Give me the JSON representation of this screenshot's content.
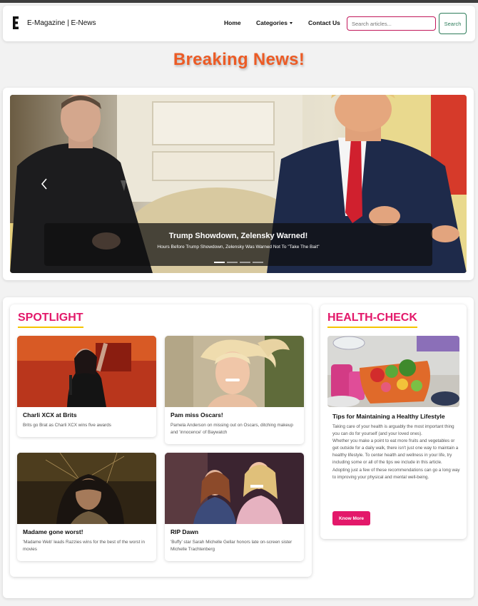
{
  "nav": {
    "brand": "E-Magazine | E-News",
    "links": [
      "Home",
      "Categories",
      "Contact Us"
    ],
    "search_placeholder": "Search articles...",
    "search_button": "Search"
  },
  "breaking": "Breaking News!",
  "carousel": {
    "title": "Trump Showdown, Zelensky Warned!",
    "subtitle": "Hours Before Trump Showdown, Zelensky Was Warned Not To \"Take The Bait\"",
    "slide_count": 4,
    "active_slide": 1
  },
  "spotlight": {
    "heading": "SPOTLIGHT",
    "items": [
      {
        "title": "Charli XCX at Brits",
        "desc": "Brits go Brat as Charli XCX wins five awards"
      },
      {
        "title": "Pam miss Oscars!",
        "desc": "Pamela Anderson on missing out on Oscars, ditching makeup and 'innocence' of Baywatch"
      },
      {
        "title": "Madame gone worst!",
        "desc": "'Madame Web' leads Razzies wins for the best of the worst in movies"
      },
      {
        "title": "RIP Dawn",
        "desc": "'Buffy' star Sarah Michelle Gellar honors late on-screen sister Michelle Trachtenberg"
      }
    ]
  },
  "health": {
    "heading": "HEALTH-CHECK",
    "title": "Tips for Maintaining a Healthy Lifestyle",
    "paragraphs": [
      "Taking care of your health is arguably the most important thing you can do for yourself (and your loved ones).",
      "Whether you make a point to eat more fruits and vegetables or get outside for a daily walk, there isn't just one way to maintain a healthy lifestyle. To center health and wellness in your life, try including some or all of the tips we include in this article.",
      "Adopting just a few of these recommendations can go a long way to improving your physical and mental well-being."
    ],
    "button": "Know More"
  },
  "colors": {
    "accent": "#e3186a",
    "headline": "#ec5b25",
    "underline": "#f5c400",
    "search_border": "#c2185b",
    "search_button": "#2e7d5b"
  }
}
